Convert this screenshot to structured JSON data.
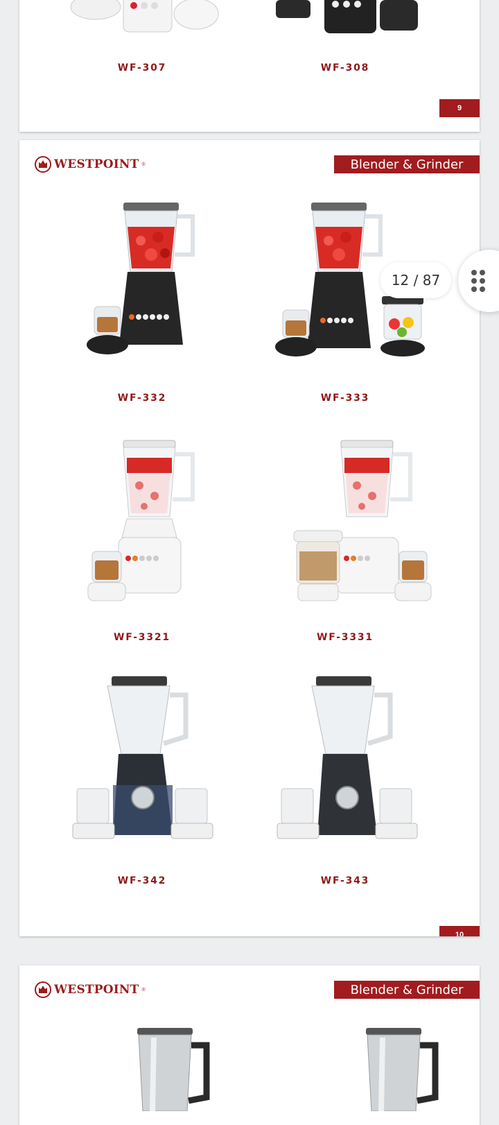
{
  "page_prev": {
    "models": [
      "WF-307",
      "WF-308"
    ],
    "page_number": "9"
  },
  "page_main": {
    "brand": "WESTPOINT",
    "category": "Blender & Grinder",
    "models": [
      "WF-332",
      "WF-333",
      "WF-3321",
      "WF-3331",
      "WF-342",
      "WF-343"
    ],
    "page_number": "10"
  },
  "page_next": {
    "brand": "WESTPOINT",
    "category": "Blender & Grinder"
  },
  "viewer": {
    "page_counter": "12 / 87",
    "menu_icon": "grip-dots-icon"
  },
  "colors": {
    "brand_red": "#a11c1f",
    "model_text": "#8e1a1a",
    "background": "#eceef0"
  }
}
